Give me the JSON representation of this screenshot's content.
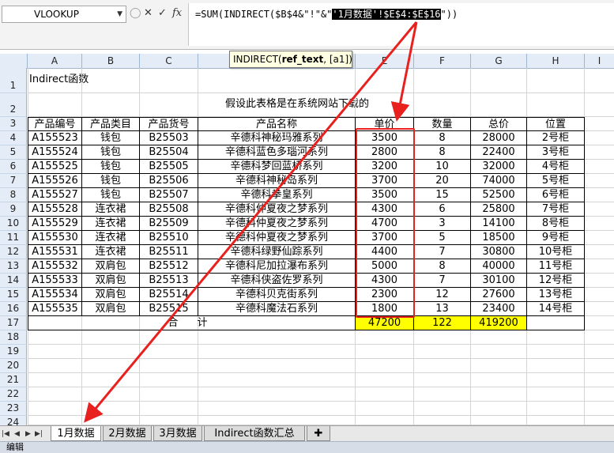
{
  "formula_bar": {
    "name_box": "VLOOKUP",
    "formula_prefix": "=SUM(INDIRECT($B$4&\"!\"&\"",
    "formula_selected": "'1月数据'!$E$4:$E$16",
    "formula_suffix": "\"))",
    "tooltip_func": "INDIRECT(",
    "tooltip_arg": "ref_text",
    "tooltip_rest": ", [a1])"
  },
  "columns": [
    "A",
    "B",
    "C",
    "D",
    "E",
    "F",
    "G",
    "H",
    "I"
  ],
  "rows": [
    "1",
    "2",
    "3",
    "4",
    "5",
    "6",
    "7",
    "8",
    "9",
    "10",
    "11",
    "12",
    "13",
    "14",
    "15",
    "16",
    "17",
    "18",
    "19",
    "20",
    "21",
    "22",
    "23",
    "24"
  ],
  "sheet": {
    "title": "Indirect函数",
    "note": "假设此表格是在系统网站下载的",
    "headers": [
      "产品编号",
      "产品类目",
      "产品货号",
      "产品名称",
      "单价",
      "数量",
      "总价",
      "位置"
    ],
    "data": [
      [
        "A155523",
        "钱包",
        "B25503",
        "辛德科神秘玛雅系列",
        "3500",
        "8",
        "28000",
        "2号柜"
      ],
      [
        "A155524",
        "钱包",
        "B25504",
        "辛德科蓝色多瑙河系列",
        "2800",
        "8",
        "22400",
        "3号柜"
      ],
      [
        "A155525",
        "钱包",
        "B25505",
        "辛德科梦回蓝桥系列",
        "3200",
        "10",
        "32000",
        "4号柜"
      ],
      [
        "A155526",
        "钱包",
        "B25506",
        "辛德科神秘岛系列",
        "3700",
        "20",
        "74000",
        "5号柜"
      ],
      [
        "A155527",
        "钱包",
        "B25507",
        "辛德科拳皇系列",
        "3500",
        "15",
        "52500",
        "6号柜"
      ],
      [
        "A155528",
        "连衣裙",
        "B25508",
        "辛德科仲夏夜之梦系列",
        "4300",
        "6",
        "25800",
        "7号柜"
      ],
      [
        "A155529",
        "连衣裙",
        "B25509",
        "辛德科仲夏夜之梦系列",
        "4700",
        "3",
        "14100",
        "8号柜"
      ],
      [
        "A155530",
        "连衣裙",
        "B25510",
        "辛德科仲夏夜之梦系列",
        "3700",
        "5",
        "18500",
        "9号柜"
      ],
      [
        "A155531",
        "连衣裙",
        "B25511",
        "辛德科绿野仙踪系列",
        "4400",
        "7",
        "30800",
        "10号柜"
      ],
      [
        "A155532",
        "双肩包",
        "B25512",
        "辛德科尼加拉瀑布系列",
        "5000",
        "8",
        "40000",
        "11号柜"
      ],
      [
        "A155533",
        "双肩包",
        "B25513",
        "辛德科侠盗佐罗系列",
        "4300",
        "7",
        "30100",
        "12号柜"
      ],
      [
        "A155534",
        "双肩包",
        "B25514",
        "辛德科贝克街系列",
        "2300",
        "12",
        "27600",
        "13号柜"
      ],
      [
        "A155535",
        "双肩包",
        "B25515",
        "辛德科魔法石系列",
        "1800",
        "13",
        "23400",
        "14号柜"
      ]
    ],
    "total_label": "合 计",
    "totals": [
      "47200",
      "122",
      "419200"
    ]
  },
  "tabs": [
    "1月数据",
    "2月数据",
    "3月数据",
    "Indirect函数汇总"
  ],
  "status": "编辑",
  "colors": {
    "highlight": "#ffff00",
    "annotation": "#e8201e",
    "header_bg": "#e4ecf7"
  },
  "icons": [
    "dropdown-arrow-icon",
    "cancel-icon",
    "confirm-icon",
    "function-icon",
    "new-sheet-icon"
  ]
}
